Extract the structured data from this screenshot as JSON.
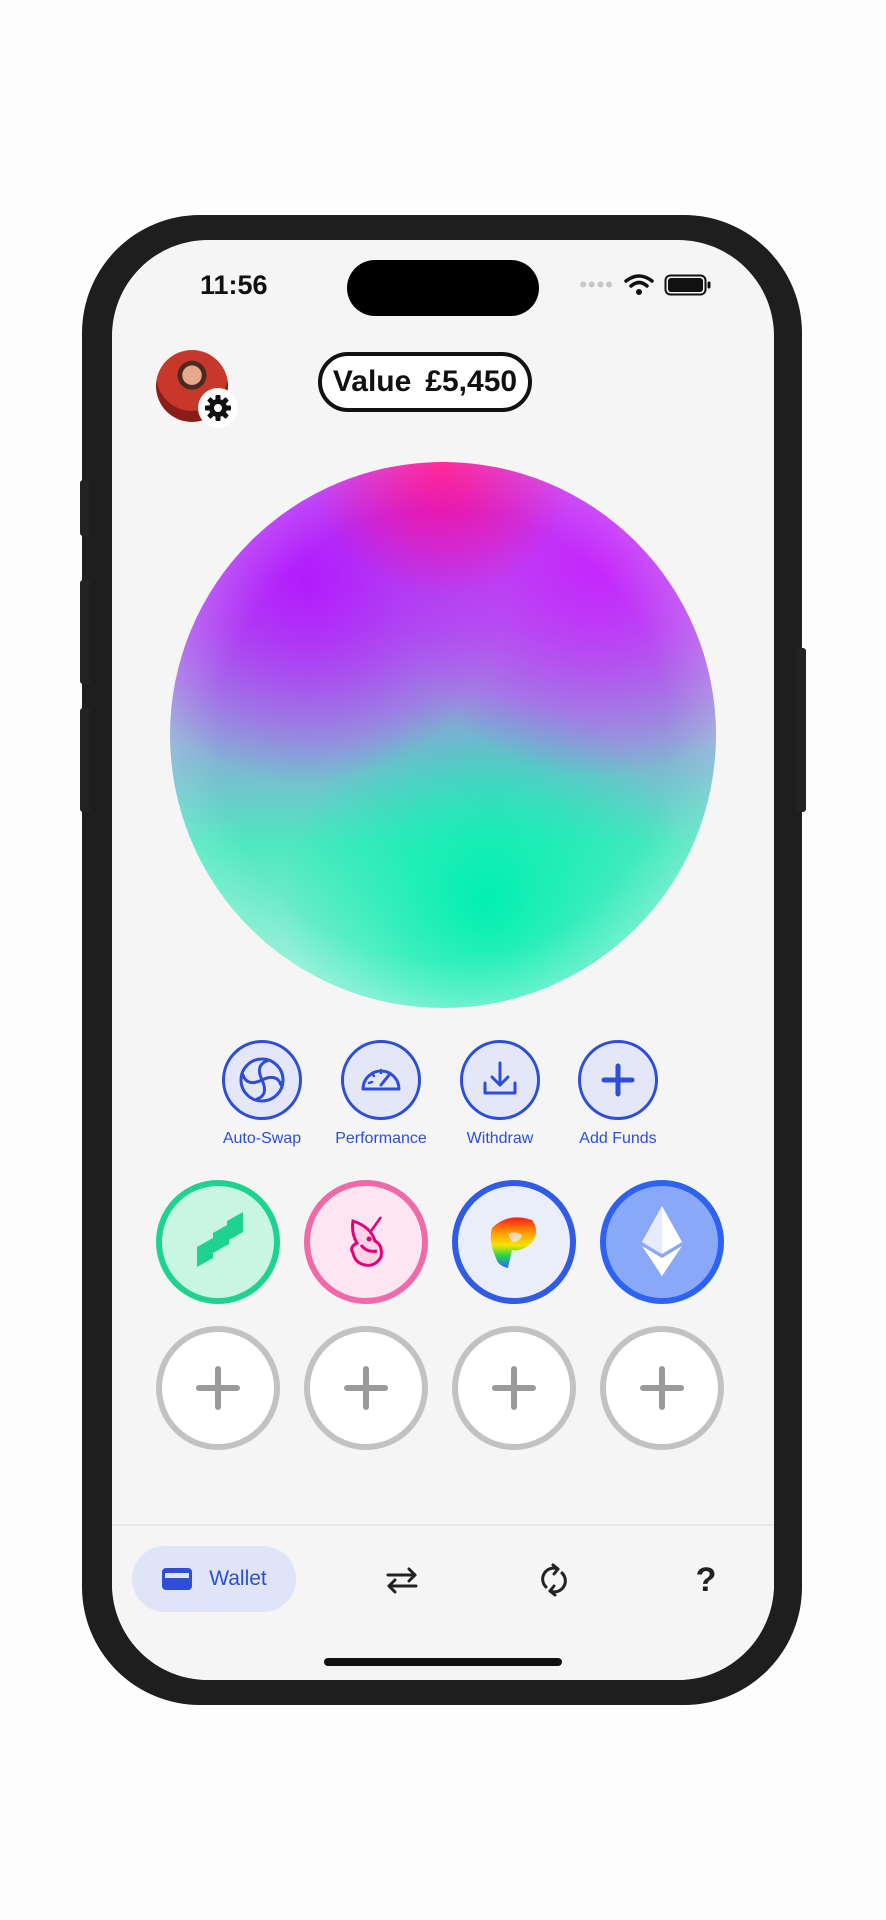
{
  "status_bar": {
    "time": "11:56",
    "icons": [
      "cellular-dots-icon",
      "wifi-icon",
      "battery-icon"
    ]
  },
  "header": {
    "avatar": "profile-avatar",
    "settings_icon": "gear-icon",
    "value_label": "Value",
    "value_amount": "£5,450"
  },
  "actions": [
    {
      "label": "Auto-Swap",
      "icon": "swirl-icon"
    },
    {
      "label": "Performance",
      "icon": "speedometer-icon"
    },
    {
      "label": "Withdraw",
      "icon": "download-icon"
    },
    {
      "label": "Add Funds",
      "icon": "plus-icon"
    }
  ],
  "tokens": [
    {
      "name": "compound-token",
      "icon": "compound-icon",
      "color": "#1ed291"
    },
    {
      "name": "uniswap-token",
      "icon": "unicorn-icon",
      "color": "#ef6aa7"
    },
    {
      "name": "curve-token",
      "icon": "curve-icon",
      "color": "#2f5be8"
    },
    {
      "name": "ethereum-token",
      "icon": "ethereum-icon",
      "color": "#2d63f5"
    }
  ],
  "empty_slots": 4,
  "tab_bar": {
    "wallet_label": "Wallet",
    "tabs": [
      "wallet-icon",
      "swap-arrows-icon",
      "refresh-icon",
      "help-icon"
    ],
    "help_glyph": "?"
  },
  "colors": {
    "accent": "#2e4ed8",
    "accent_soft": "#e3e7f7",
    "slot_border": "#c2c2c2"
  }
}
